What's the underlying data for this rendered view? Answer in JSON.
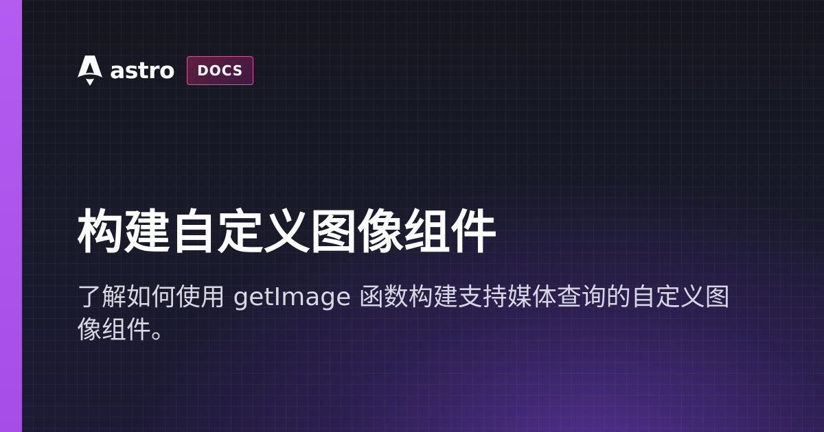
{
  "brand": {
    "name": "astro",
    "badge": "DOCS",
    "accent_color": "#a855f7",
    "badge_border_color": "#d8589b"
  },
  "page": {
    "title": "构建自定义图像组件",
    "description": "了解如何使用 getImage 函数构建支持媒体查询的自定义图像组件。"
  },
  "icons": {
    "logo": "astro-rocket-logo-icon"
  }
}
